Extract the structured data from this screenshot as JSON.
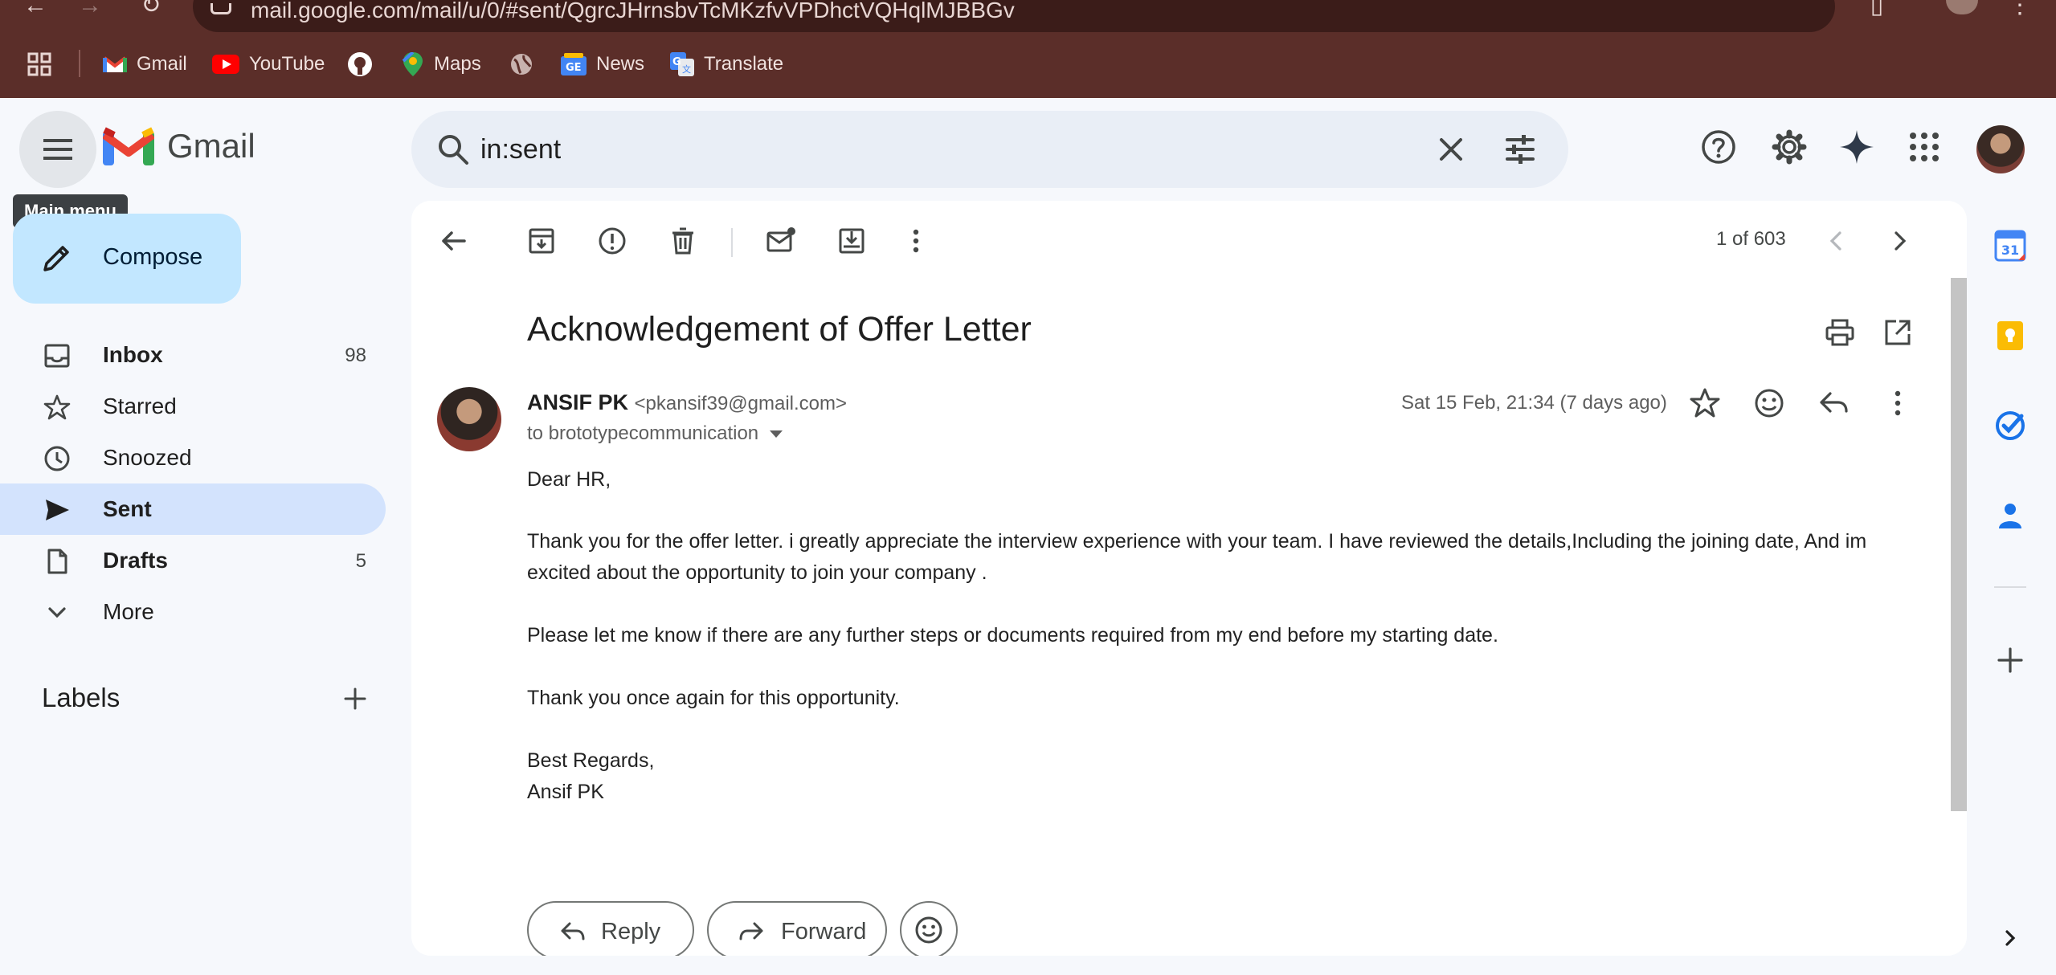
{
  "browser": {
    "url": "mail.google.com/mail/u/0/#sent/QgrcJHrnsbvTcMKzfvVPDhctVQHqlMJBBGv",
    "bookmarks": [
      {
        "label": "Gmail"
      },
      {
        "label": "YouTube"
      },
      {
        "label": ""
      },
      {
        "label": "Maps"
      },
      {
        "label": ""
      },
      {
        "label": "News"
      },
      {
        "label": "Translate"
      }
    ]
  },
  "header": {
    "app_name": "Gmail",
    "menu_tooltip": "Main menu",
    "search_query": "in:sent"
  },
  "sidebar": {
    "compose_label": "Compose",
    "items": [
      {
        "label": "Inbox",
        "count": "98"
      },
      {
        "label": "Starred",
        "count": ""
      },
      {
        "label": "Snoozed",
        "count": ""
      },
      {
        "label": "Sent",
        "count": ""
      },
      {
        "label": "Drafts",
        "count": "5"
      },
      {
        "label": "More",
        "count": ""
      }
    ],
    "labels_title": "Labels"
  },
  "toolbar": {
    "pager": "1 of 603"
  },
  "message": {
    "subject": "Acknowledgement of Offer Letter",
    "sender_name": "ANSIF PK",
    "sender_email": "<pkansif39@gmail.com>",
    "recipient": "to brototypecommunication",
    "date": "Sat 15 Feb, 21:34 (7 days ago)",
    "body": {
      "greeting": "Dear HR,",
      "para1": "Thank you for the offer letter. i greatly appreciate the interview experience with your team. I have reviewed the details,Including the joining date, And im excited about the opportunity to join your company .",
      "para2": "Please let me know if there are any further steps or documents required from my end before my starting date.",
      "para3": "Thank you once again for this opportunity.",
      "closing": "Best Regards,",
      "signature": "Ansif PK"
    }
  },
  "actions": {
    "reply_label": "Reply",
    "forward_label": "Forward"
  },
  "colors": {
    "chrome_bg": "#5b2e29",
    "active_nav": "#d3e3fd",
    "compose_bg": "#c2e7ff",
    "page_bg": "#f6f8fc"
  },
  "rail_badge": "31"
}
